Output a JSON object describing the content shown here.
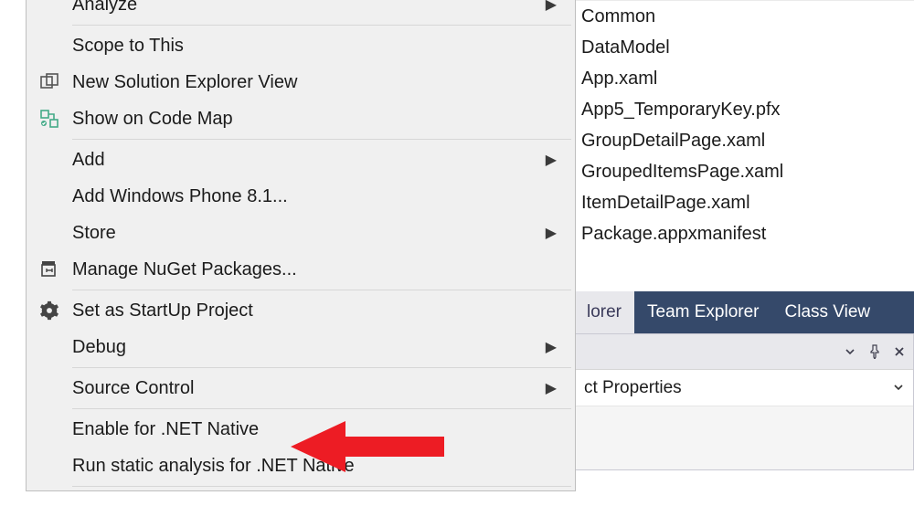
{
  "contextMenu": {
    "items": [
      {
        "label": "Analyze",
        "hasSubmenu": true,
        "icon": null
      },
      {
        "sep": true
      },
      {
        "label": "Scope to This",
        "hasSubmenu": false,
        "icon": null
      },
      {
        "label": "New Solution Explorer View",
        "hasSubmenu": false,
        "icon": "new-window-icon"
      },
      {
        "label": "Show on Code Map",
        "hasSubmenu": false,
        "icon": "codemap-icon"
      },
      {
        "sep": true
      },
      {
        "label": "Add",
        "hasSubmenu": true,
        "icon": null
      },
      {
        "label": "Add Windows Phone 8.1...",
        "hasSubmenu": false,
        "icon": null
      },
      {
        "label": "Store",
        "hasSubmenu": true,
        "icon": null
      },
      {
        "label": "Manage NuGet Packages...",
        "hasSubmenu": false,
        "icon": "nuget-icon"
      },
      {
        "sep": true
      },
      {
        "label": "Set as StartUp Project",
        "hasSubmenu": false,
        "icon": "gear-icon"
      },
      {
        "label": "Debug",
        "hasSubmenu": true,
        "icon": null
      },
      {
        "sep": true
      },
      {
        "label": "Source Control",
        "hasSubmenu": true,
        "icon": null
      },
      {
        "sep": true
      },
      {
        "label": "Enable for .NET Native",
        "hasSubmenu": false,
        "icon": null,
        "annotated": true
      },
      {
        "label": "Run static analysis for .NET Native",
        "hasSubmenu": false,
        "icon": null
      },
      {
        "sep": true
      }
    ]
  },
  "files": [
    "Common",
    "DataModel",
    "App.xaml",
    "App5_TemporaryKey.pfx",
    "GroupDetailPage.xaml",
    "GroupedItemsPage.xaml",
    "ItemDetailPage.xaml",
    "Package.appxmanifest"
  ],
  "tabs": {
    "inactive": "lorer",
    "team": "Team Explorer",
    "classview": "Class View"
  },
  "propsHeader": {
    "pin_glyph": "",
    "close_glyph": ""
  },
  "propsTitle": "ct Properties",
  "annotation": {
    "color": "#ed1c24"
  }
}
